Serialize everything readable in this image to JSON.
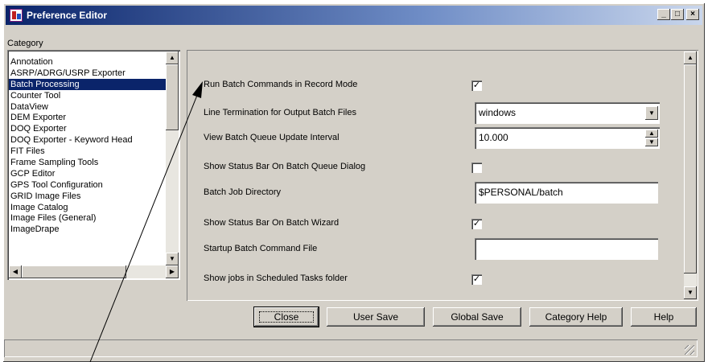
{
  "window": {
    "title": "Preference Editor"
  },
  "titlebar_buttons": {
    "minimize": "_",
    "maximize": "□",
    "close": "×"
  },
  "category": {
    "label": "Category",
    "items": [
      "Annotation",
      "ASRP/ADRG/USRP Exporter",
      "Batch Processing",
      "Counter Tool",
      "DataView",
      "DEM Exporter",
      "DOQ Exporter",
      "DOQ Exporter - Keyword Head",
      "FIT Files",
      "Frame Sampling Tools",
      "GCP Editor",
      "GPS Tool Configuration",
      "GRID Image Files",
      "Image Catalog",
      "Image Files (General)",
      "ImageDrape"
    ],
    "selected": "Batch Processing"
  },
  "preferences": [
    {
      "label": "Run Batch Commands in Record Mode",
      "type": "checkbox",
      "checked": true
    },
    {
      "label": "Line Termination for Output Batch Files",
      "type": "dropdown",
      "value": "windows"
    },
    {
      "label": "View Batch Queue Update Interval",
      "type": "spinner",
      "value": "10.000"
    },
    {
      "label": "Show Status Bar On Batch Queue Dialog",
      "type": "checkbox",
      "checked": false
    },
    {
      "label": "Batch Job Directory",
      "type": "text",
      "value": "$PERSONAL/batch"
    },
    {
      "label": "Show Status Bar On Batch Wizard",
      "type": "checkbox",
      "checked": true
    },
    {
      "label": "Startup Batch Command File",
      "type": "text",
      "value": ""
    },
    {
      "label": "Show jobs in Scheduled Tasks folder",
      "type": "checkbox",
      "checked": true
    }
  ],
  "buttons": {
    "close": "Close",
    "user_save": "User Save",
    "global_save": "Global Save",
    "category_help": "Category Help",
    "help": "Help"
  },
  "glyphs": {
    "check": "✓",
    "down": "▼",
    "up": "▲",
    "left": "◀",
    "right": "▶"
  },
  "colors": {
    "selection": "#0a246a",
    "face": "#d4d0c8",
    "title_start": "#0a246a"
  }
}
